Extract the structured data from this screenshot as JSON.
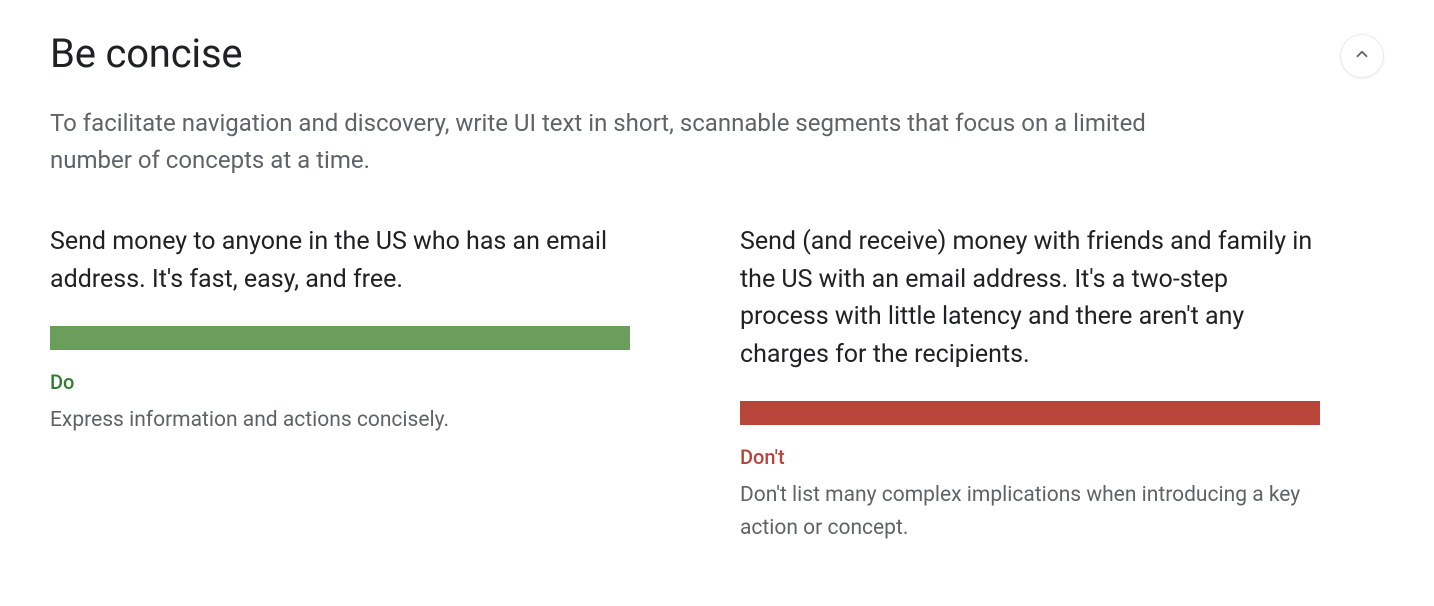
{
  "section": {
    "title": "Be concise",
    "intro": "To facilitate navigation and discovery, write UI text in short, scannable segments that focus on a limited number of concepts at a time."
  },
  "do": {
    "example": "Send money to anyone in the US who has an email address. It's fast, easy, and free.",
    "tag": "Do",
    "caption": "Express information and actions concisely."
  },
  "dont": {
    "example": "Send (and receive) money with friends and family in the US with an email address. It's a two-step process with little latency and there aren't any charges for the recipients.",
    "tag": "Don't",
    "caption": "Don't list many complex implications when introducing a key action or concept."
  }
}
